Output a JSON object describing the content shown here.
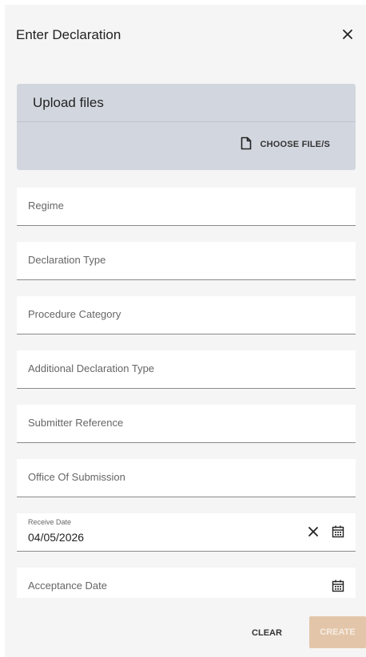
{
  "dialog": {
    "title": "Enter Declaration",
    "close_icon": "close-icon"
  },
  "upload": {
    "title": "Upload files",
    "choose_label": "CHOOSE FILE/S",
    "choose_icon": "file-icon"
  },
  "fields": {
    "regime": {
      "label": "Regime"
    },
    "declaration_type": {
      "label": "Declaration Type"
    },
    "procedure_category": {
      "label": "Procedure Category"
    },
    "additional_declaration_type": {
      "label": "Additional Declaration Type"
    },
    "submitter_reference": {
      "label": "Submitter Reference"
    },
    "office_of_submission": {
      "label": "Office Of Submission"
    },
    "receive_date": {
      "label": "Receive Date",
      "value": "04/05/2026"
    },
    "acceptance_date": {
      "label": "Acceptance Date"
    }
  },
  "actions": {
    "clear_label": "CLEAR",
    "create_label": "CREATE"
  },
  "colors": {
    "upload_bg": "#d2d7df",
    "create_disabled_bg": "#e3c6aa"
  }
}
